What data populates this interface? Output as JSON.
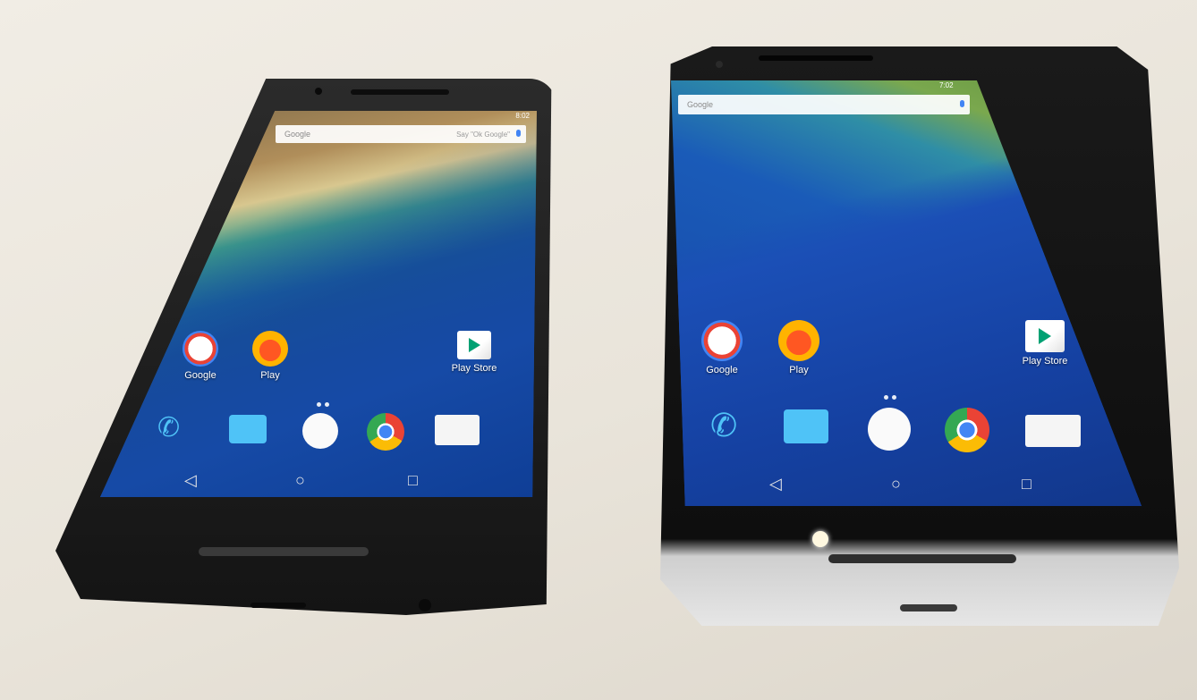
{
  "phones": [
    {
      "status_time": "8:02",
      "search": {
        "placeholder": "Google",
        "hint": "Say \"Ok Google\""
      },
      "apps": [
        {
          "label": "Google",
          "icon": "google-icon"
        },
        {
          "label": "Play",
          "icon": "play-music-icon"
        },
        {
          "label": "Play Store",
          "icon": "play-store-icon"
        }
      ],
      "dock": [
        "phone-icon",
        "messenger-icon",
        "app-drawer-icon",
        "chrome-icon",
        "camera-icon"
      ],
      "nav": [
        "back-icon",
        "home-icon",
        "recents-icon"
      ]
    },
    {
      "status_time": "7:02",
      "search": {
        "placeholder": "Google",
        "hint": ""
      },
      "apps": [
        {
          "label": "Google",
          "icon": "google-icon"
        },
        {
          "label": "Play",
          "icon": "play-music-icon"
        },
        {
          "label": "Play Store",
          "icon": "play-store-icon"
        }
      ],
      "dock": [
        "phone-icon",
        "messenger-icon",
        "app-drawer-icon",
        "chrome-icon",
        "camera-icon"
      ],
      "nav": [
        "back-icon",
        "home-icon",
        "recents-icon"
      ]
    }
  ],
  "colors": {
    "body_left": "#1f1f1f",
    "body_right": "#151515",
    "frame_right": "#cfcfcf",
    "ocean": "#1a4fb0",
    "google_blue": "#4285f4"
  }
}
